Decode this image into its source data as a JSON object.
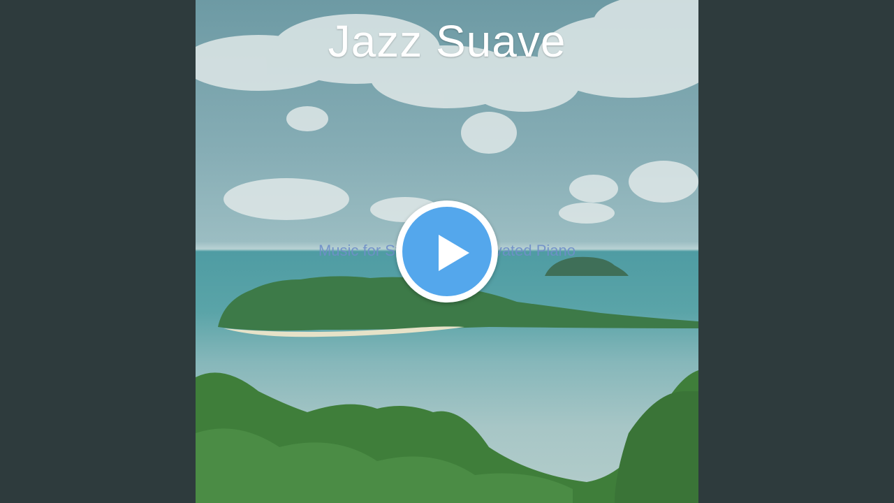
{
  "cover": {
    "title": "Jazz Suave",
    "subtitle": "Music for Studying - Captivated Piano"
  },
  "player": {
    "play_button_icon": "play-icon",
    "accent_color": "#54a7ec",
    "background_color": "#2e3b3d"
  }
}
